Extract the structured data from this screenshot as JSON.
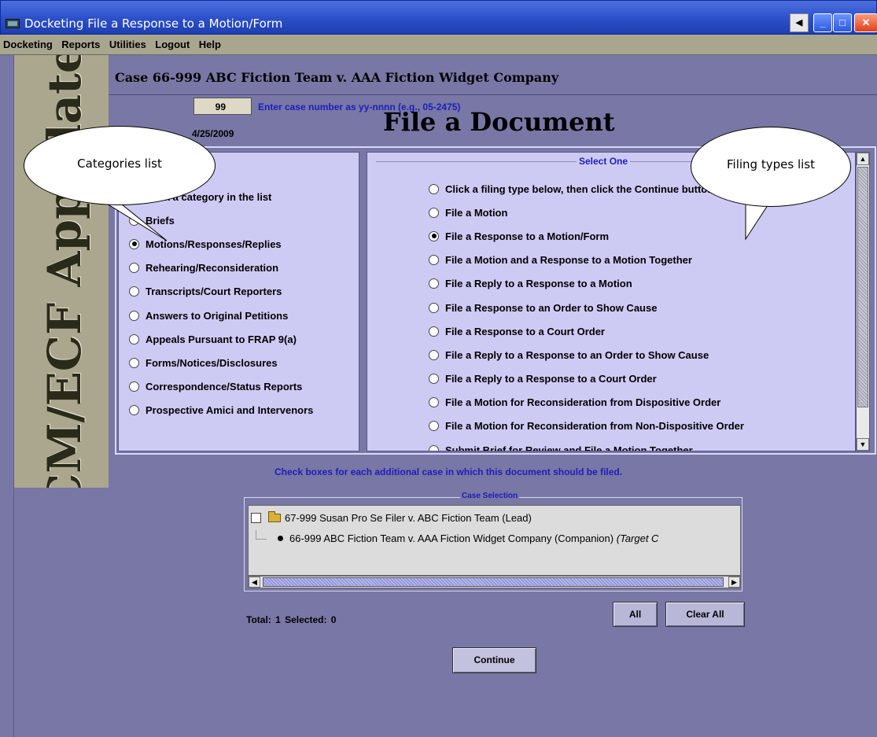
{
  "window": {
    "title": "Docketing File a Response to a Motion/Form",
    "buttons": [
      "back",
      "minimize",
      "maximize",
      "close"
    ]
  },
  "menu": [
    "Docketing",
    "Reports",
    "Utilities",
    "Logout",
    "Help"
  ],
  "banner": "CM/ECF Appellate",
  "case_header": "Case 66-999 ABC Fiction Team v. AAA Fiction Widget Company",
  "page_title": "File a Document",
  "case_number": {
    "value": "99",
    "hint": "Enter case number as yy-nnnn (e.g., 05-2475)"
  },
  "date_text": "4/25/2009",
  "categories": {
    "items": [
      {
        "label": "Click a category in the list",
        "selected": false
      },
      {
        "label": "Briefs",
        "selected": false
      },
      {
        "label": "Motions/Responses/Replies",
        "selected": true
      },
      {
        "label": "Rehearing/Reconsideration",
        "selected": false
      },
      {
        "label": "Transcripts/Court Reporters",
        "selected": false
      },
      {
        "label": "Answers to Original Petitions",
        "selected": false
      },
      {
        "label": "Appeals Pursuant to FRAP 9(a)",
        "selected": false
      },
      {
        "label": "Forms/Notices/Disclosures",
        "selected": false
      },
      {
        "label": "Correspondence/Status Reports",
        "selected": false
      },
      {
        "label": "Prospective Amici and Intervenors",
        "selected": false
      }
    ]
  },
  "filing_types": {
    "legend": "Select One",
    "items": [
      {
        "label": "Click a filing type below, then click the Continue button",
        "selected": false
      },
      {
        "label": "File a Motion",
        "selected": false
      },
      {
        "label": "File a Response to a Motion/Form",
        "selected": true
      },
      {
        "label": "File a Motion and a Response to a Motion Together",
        "selected": false
      },
      {
        "label": "File a Reply to a Response to a Motion",
        "selected": false
      },
      {
        "label": "File a Response to an Order to Show Cause",
        "selected": false
      },
      {
        "label": "File a Response to a Court Order",
        "selected": false
      },
      {
        "label": "File a Reply to a Response to an Order to Show Cause",
        "selected": false
      },
      {
        "label": "File a Reply to a Response to a Court Order",
        "selected": false
      },
      {
        "label": "File a Motion for Reconsideration from Dispositive Order",
        "selected": false
      },
      {
        "label": "File a Motion for Reconsideration from Non-Dispositive Order",
        "selected": false
      },
      {
        "label": "Submit Brief for Review and File a Motion Together",
        "selected": false
      }
    ]
  },
  "check_hint": "Check boxes for each additional case in which this document should be filed.",
  "case_selection": {
    "title": "Case Selection",
    "lead": "67-999 Susan Pro Se Filer v. ABC Fiction Team (Lead)",
    "companion": "66-999 ABC Fiction Team v. AAA Fiction Widget Company (Companion)",
    "companion_suffix": "(Target C"
  },
  "totals": {
    "label": "Total: 1   Selected: 0"
  },
  "buttons": {
    "all": "All",
    "clear_all": "Clear All",
    "continue": "Continue"
  },
  "callouts": {
    "categories": "Categories list",
    "filing_types": "Filing types list"
  }
}
